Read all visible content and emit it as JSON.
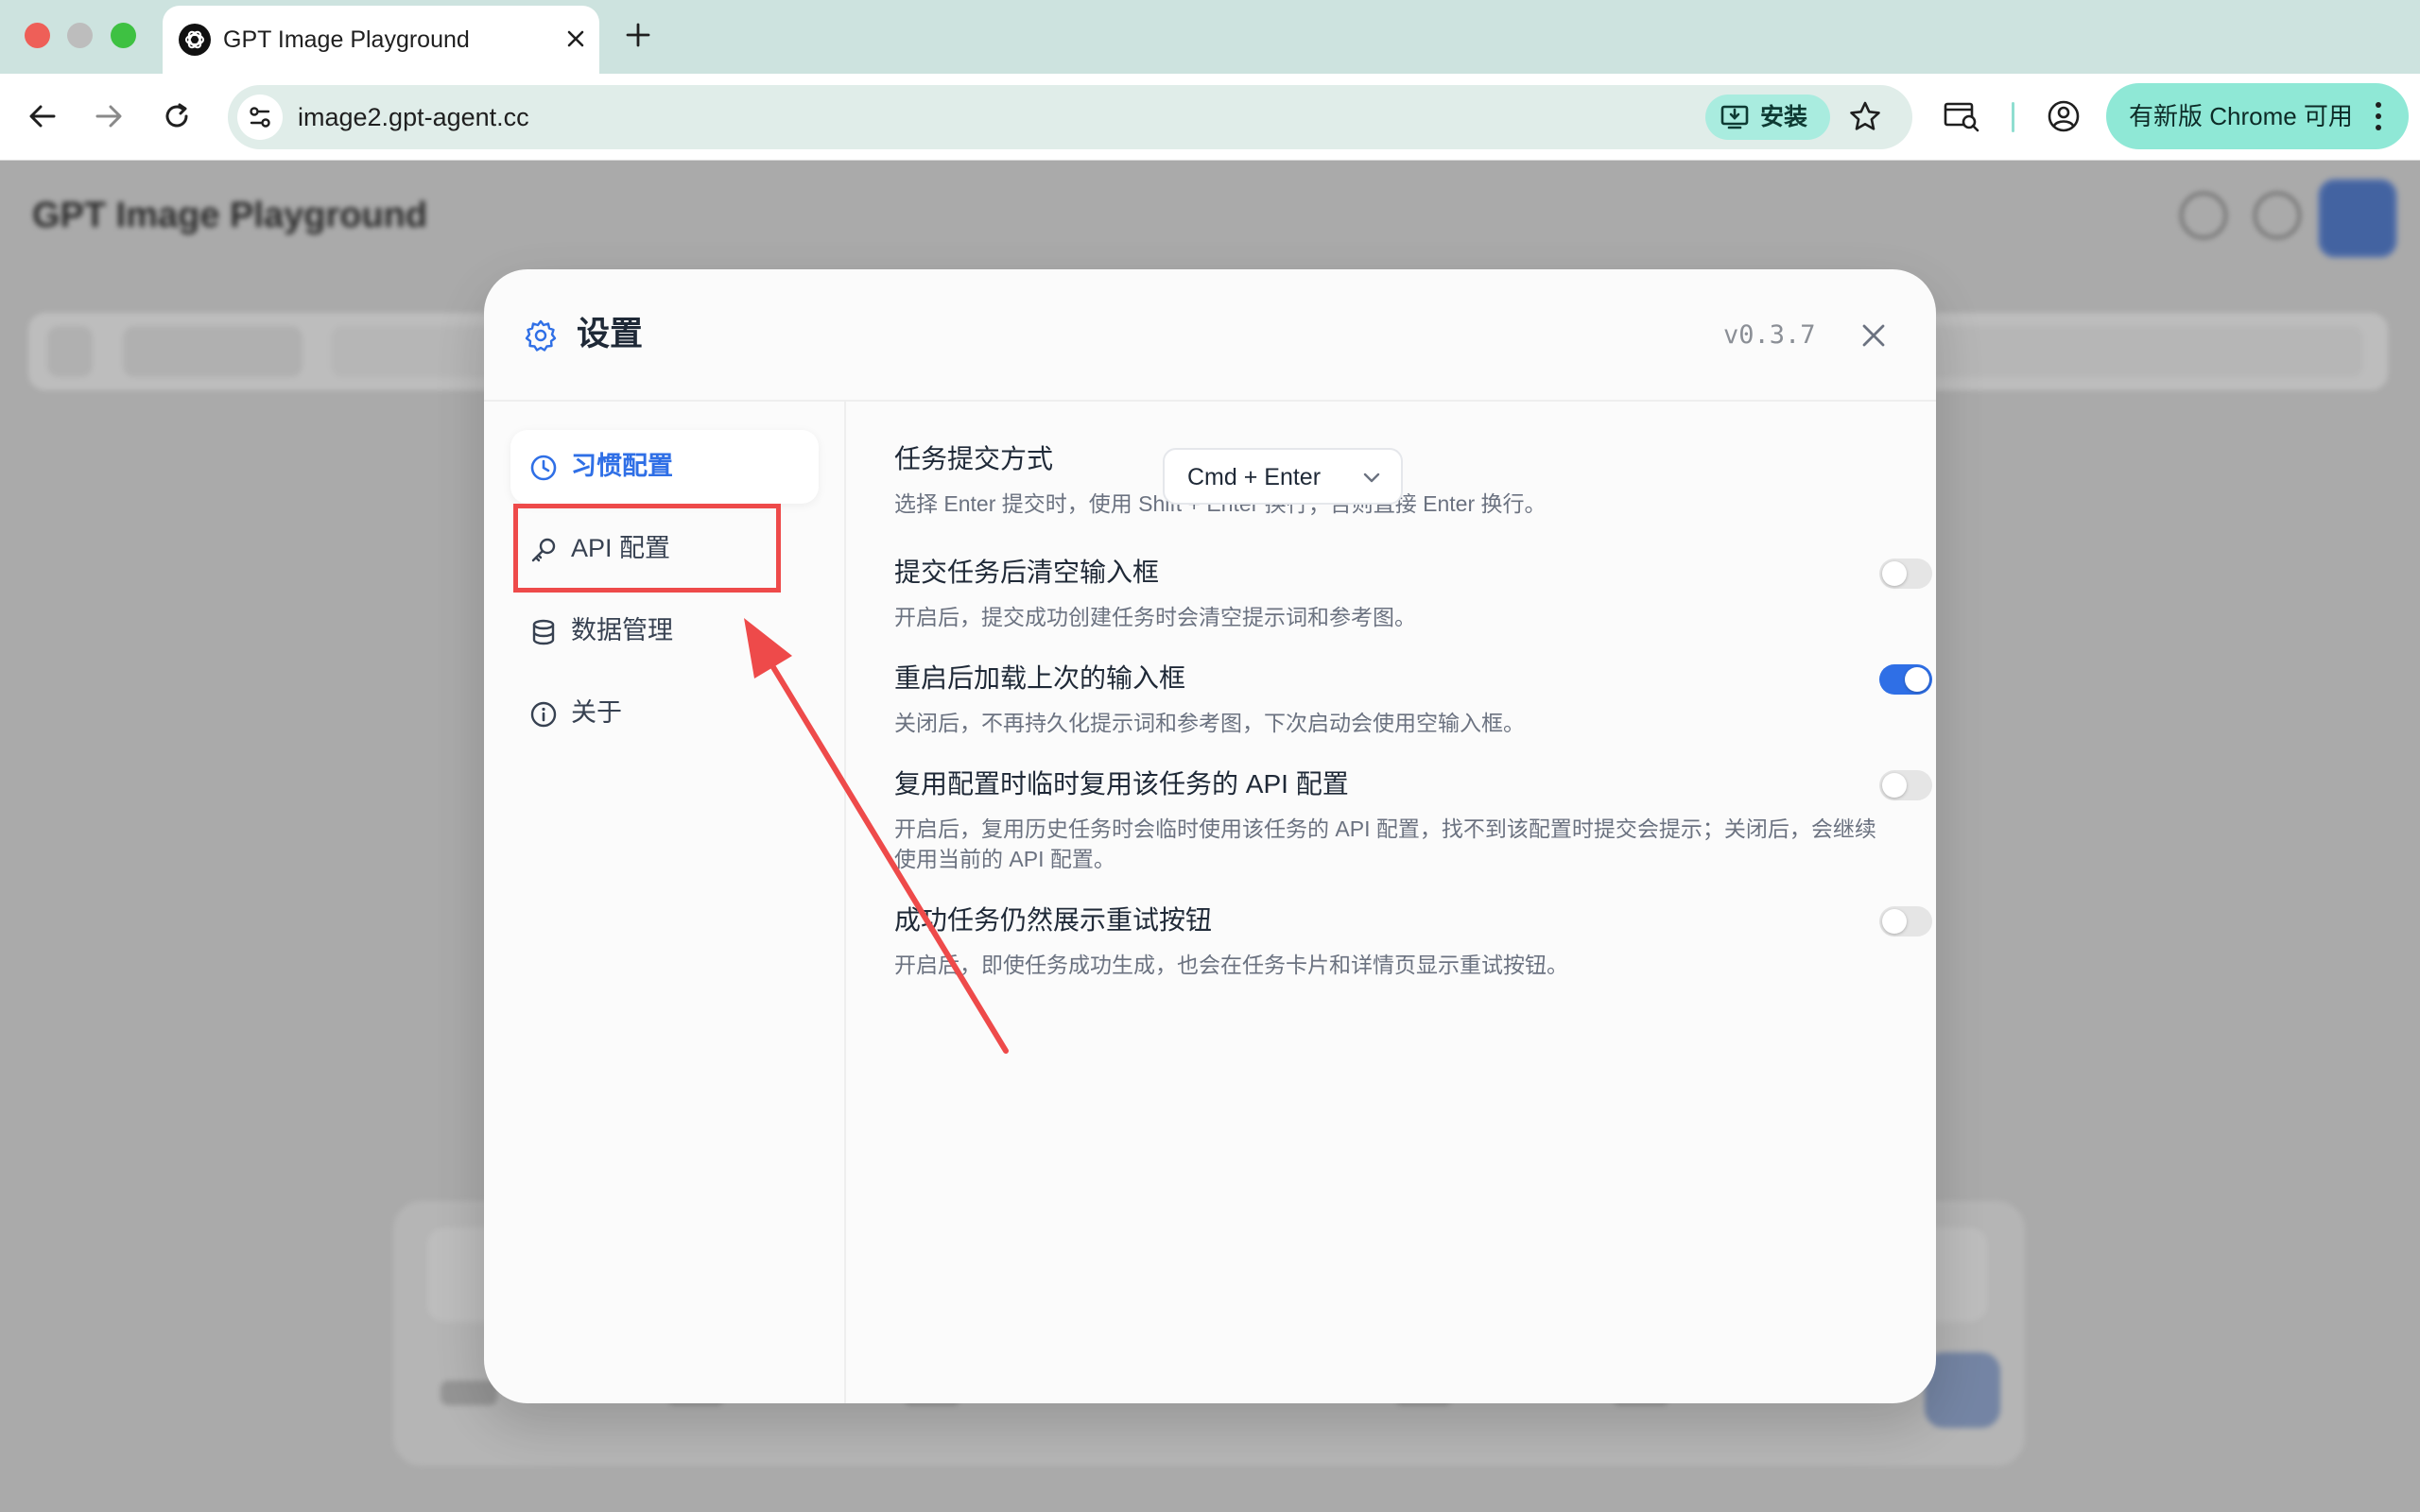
{
  "browser": {
    "tab": {
      "title": "GPT Image Playground"
    },
    "address_bar": {
      "url": "image2.gpt-agent.cc"
    },
    "install_label": "安装",
    "update_label": "有新版 Chrome 可用",
    "accent": "#8fe8d6"
  },
  "background_page": {
    "title": "GPT Image Playground"
  },
  "modal": {
    "title": "设置",
    "version": "v0.3.7",
    "sidebar": {
      "items": [
        {
          "label": "习惯配置",
          "icon": "clock-icon",
          "active": true
        },
        {
          "label": "API 配置",
          "icon": "key-icon",
          "active": false
        },
        {
          "label": "数据管理",
          "icon": "database-icon",
          "active": false
        },
        {
          "label": "关于",
          "icon": "info-icon",
          "active": false
        }
      ]
    },
    "settings": [
      {
        "title": "任务提交方式",
        "description": "选择 Enter 提交时，使用 Shift + Enter 换行；否则直接 Enter 换行。",
        "control": "select",
        "value": "Cmd + Enter"
      },
      {
        "title": "提交任务后清空输入框",
        "description": "开启后，提交成功创建任务时会清空提示词和参考图。",
        "control": "toggle",
        "enabled": false
      },
      {
        "title": "重启后加载上次的输入框",
        "description": "关闭后，不再持久化提示词和参考图，下次启动会使用空输入框。",
        "control": "toggle",
        "enabled": true
      },
      {
        "title": "复用配置时临时复用该任务的 API 配置",
        "description": "开启后，复用历史任务时会临时使用该任务的 API 配置，找不到该配置时提交会提示；关闭后，会继续使用当前的 API 配置。",
        "control": "toggle",
        "enabled": false
      },
      {
        "title": "成功任务仍然展示重试按钮",
        "description": "开启后，即使任务成功生成，也会在任务卡片和详情页显示重试按钮。",
        "control": "toggle",
        "enabled": false
      }
    ],
    "accent": "#2f6fe6"
  },
  "annotation": {
    "color": "#ee4a4a",
    "target": "API 配置"
  }
}
